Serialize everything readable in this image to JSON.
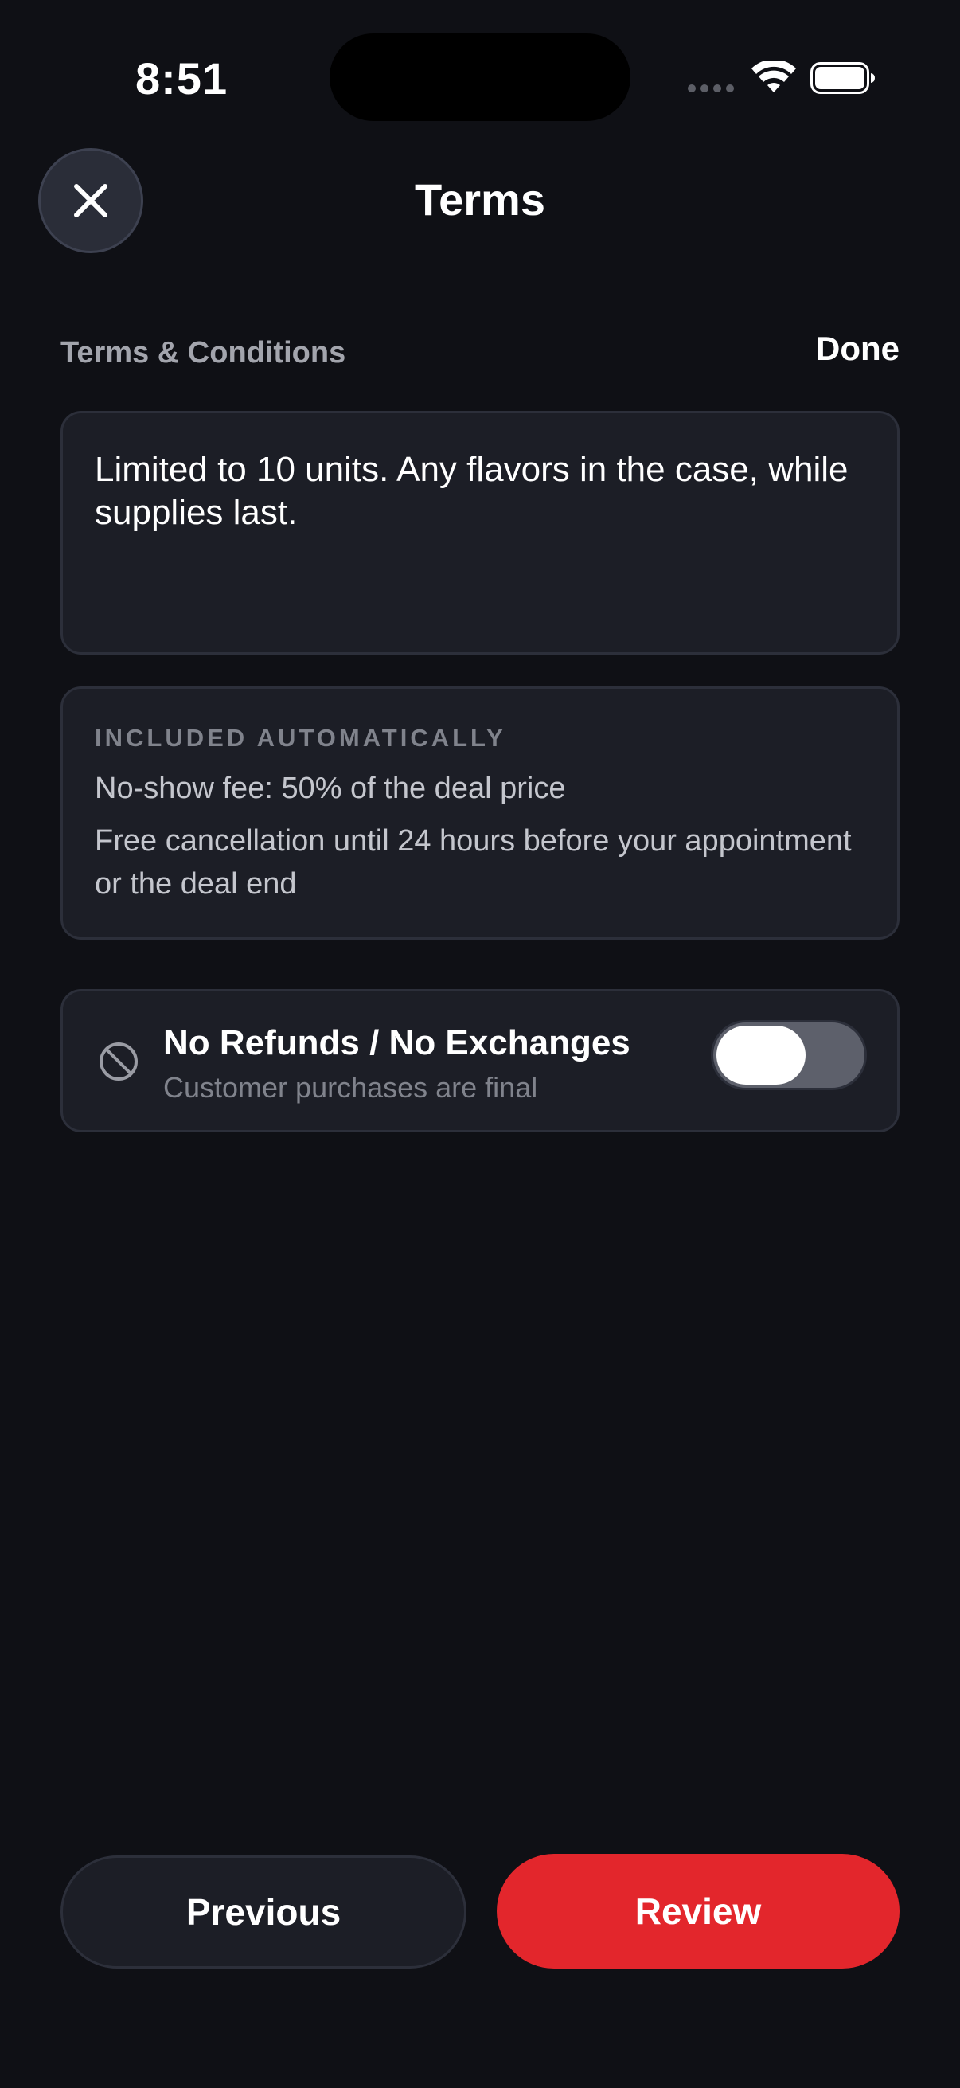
{
  "status_bar": {
    "time": "8:51",
    "icons": [
      "signal-dots-icon",
      "wifi-icon",
      "battery-icon"
    ]
  },
  "header": {
    "title": "Terms",
    "close_icon": "close-icon"
  },
  "section": {
    "label": "Terms & Conditions",
    "done_label": "Done"
  },
  "terms_input": {
    "value": "Limited to 10 units. Any flavors in the case, while supplies last."
  },
  "included": {
    "heading": "INCLUDED AUTOMATICALLY",
    "lines": [
      "No-show fee: 50% of the deal price",
      "Free cancellation until 24 hours before your appointment or the deal end"
    ]
  },
  "refund_option": {
    "icon": "ban-icon",
    "title": "No Refunds / No Exchanges",
    "subtitle": "Customer purchases are final",
    "enabled": false
  },
  "footer": {
    "previous_label": "Previous",
    "review_label": "Review"
  },
  "colors": {
    "background": "#0f1015",
    "card": "#1c1e26",
    "accent": "#e3262c",
    "muted_text": "#80838c"
  }
}
